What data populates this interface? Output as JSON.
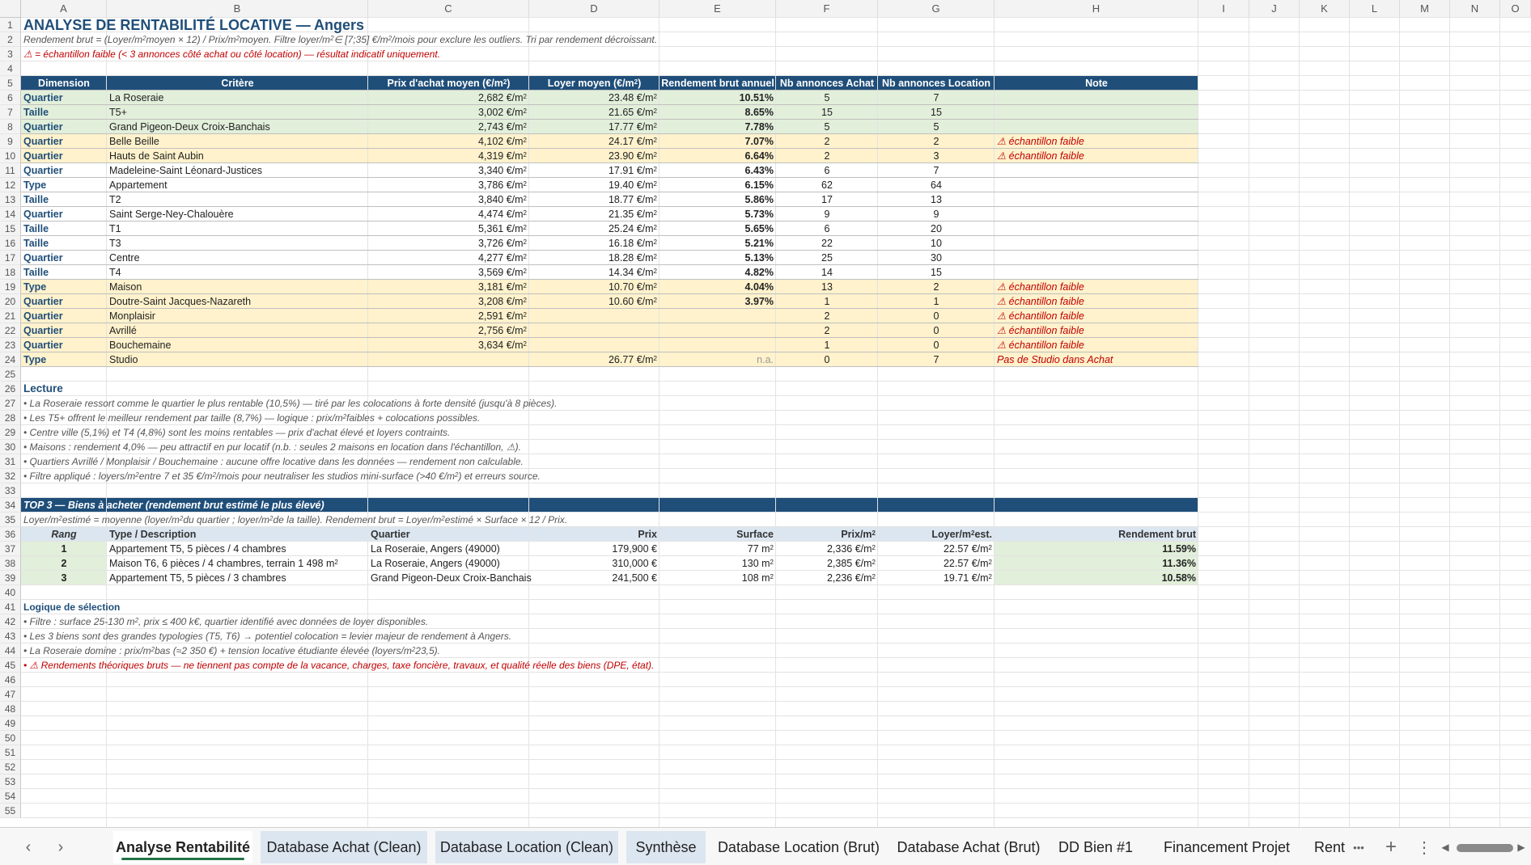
{
  "columns": [
    "A",
    "B",
    "C",
    "D",
    "E",
    "F",
    "G",
    "H",
    "I",
    "J",
    "K",
    "L",
    "M",
    "N",
    "O"
  ],
  "row_numbers": [
    "1",
    "2",
    "3",
    "4",
    "5",
    "6",
    "7",
    "8",
    "9",
    "10",
    "11",
    "12",
    "13",
    "14",
    "15",
    "16",
    "17",
    "18",
    "19",
    "20",
    "21",
    "22",
    "23",
    "24",
    "25",
    "26",
    "27",
    "28",
    "29",
    "30",
    "31",
    "32",
    "33",
    "34",
    "35",
    "36",
    "37",
    "38",
    "39",
    "40",
    "41",
    "42",
    "43",
    "44",
    "45",
    "46",
    "47",
    "48",
    "49",
    "50",
    "51",
    "52",
    "53",
    "54",
    "55"
  ],
  "colors": {
    "header_blue": "#1f4e79",
    "green_fill": "#e2efda",
    "orange_fill": "#fff2cc",
    "warn_red": "#c00000"
  },
  "title": "ANALYSE DE RENTABILITÉ LOCATIVE — Angers",
  "subtitle_parts": [
    "Rendement brut = (Loyer/m",
    " moyen × 12) / Prix/m",
    " moyen. Filtre loyer/m",
    " ∈ [7;35] €/m",
    "/mois pour exclure les outliers. Tri par rendement décroissant."
  ],
  "warning_note": "⚠ = échantillon faible (< 3 annonces côté achat ou côté location) — résultat indicatif uniquement.",
  "table_headers": [
    "Dimension",
    "Critère",
    "Prix d'achat moyen (€/m²)",
    "Loyer moyen (€/m²)",
    "Rendement brut annuel",
    "Nb annonces Achat",
    "Nb annonces Location",
    "Note"
  ],
  "rows": [
    {
      "dim": "Quartier",
      "crit": "La Roseraie",
      "prix": "2,682",
      "loyer": "23.48",
      "rend": "10.51%",
      "na": "5",
      "nl": "7",
      "note": "",
      "style": "green"
    },
    {
      "dim": "Taille",
      "crit": "T5+",
      "prix": "3,002",
      "loyer": "21.65",
      "rend": "8.65%",
      "na": "15",
      "nl": "15",
      "note": "",
      "style": "green"
    },
    {
      "dim": "Quartier",
      "crit": "Grand Pigeon-Deux Croix-Banchais",
      "prix": "2,743",
      "loyer": "17.77",
      "rend": "7.78%",
      "na": "5",
      "nl": "5",
      "note": "",
      "style": "green"
    },
    {
      "dim": "Quartier",
      "crit": "Belle Beille",
      "prix": "4,102",
      "loyer": "24.17",
      "rend": "7.07%",
      "na": "2",
      "nl": "2",
      "note": "⚠ échantillon faible",
      "style": "orange"
    },
    {
      "dim": "Quartier",
      "crit": "Hauts de Saint Aubin",
      "prix": "4,319",
      "loyer": "23.90",
      "rend": "6.64%",
      "na": "2",
      "nl": "3",
      "note": "⚠ échantillon faible",
      "style": "orange"
    },
    {
      "dim": "Quartier",
      "crit": "Madeleine-Saint Léonard-Justices",
      "prix": "3,340",
      "loyer": "17.91",
      "rend": "6.43%",
      "na": "6",
      "nl": "7",
      "note": "",
      "style": "white"
    },
    {
      "dim": "Type",
      "crit": "Appartement",
      "prix": "3,786",
      "loyer": "19.40",
      "rend": "6.15%",
      "na": "62",
      "nl": "64",
      "note": "",
      "style": "white"
    },
    {
      "dim": "Taille",
      "crit": "T2",
      "prix": "3,840",
      "loyer": "18.77",
      "rend": "5.86%",
      "na": "17",
      "nl": "13",
      "note": "",
      "style": "white"
    },
    {
      "dim": "Quartier",
      "crit": "Saint Serge-Ney-Chalouère",
      "prix": "4,474",
      "loyer": "21.35",
      "rend": "5.73%",
      "na": "9",
      "nl": "9",
      "note": "",
      "style": "white"
    },
    {
      "dim": "Taille",
      "crit": "T1",
      "prix": "5,361",
      "loyer": "25.24",
      "rend": "5.65%",
      "na": "6",
      "nl": "20",
      "note": "",
      "style": "white"
    },
    {
      "dim": "Taille",
      "crit": "T3",
      "prix": "3,726",
      "loyer": "16.18",
      "rend": "5.21%",
      "na": "22",
      "nl": "10",
      "note": "",
      "style": "white"
    },
    {
      "dim": "Quartier",
      "crit": "Centre",
      "prix": "4,277",
      "loyer": "18.28",
      "rend": "5.13%",
      "na": "25",
      "nl": "30",
      "note": "",
      "style": "white"
    },
    {
      "dim": "Taille",
      "crit": "T4",
      "prix": "3,569",
      "loyer": "14.34",
      "rend": "4.82%",
      "na": "14",
      "nl": "15",
      "note": "",
      "style": "white"
    },
    {
      "dim": "Type",
      "crit": "Maison",
      "prix": "3,181",
      "loyer": "10.70",
      "rend": "4.04%",
      "na": "13",
      "nl": "2",
      "note": "⚠ échantillon faible",
      "style": "orange"
    },
    {
      "dim": "Quartier",
      "crit": "Doutre-Saint Jacques-Nazareth",
      "prix": "3,208",
      "loyer": "10.60",
      "rend": "3.97%",
      "na": "1",
      "nl": "1",
      "note": "⚠ échantillon faible",
      "style": "orange"
    },
    {
      "dim": "Quartier",
      "crit": "Monplaisir",
      "prix": "2,591",
      "loyer": "",
      "rend": "",
      "na": "2",
      "nl": "0",
      "note": "⚠ échantillon faible",
      "style": "orange"
    },
    {
      "dim": "Quartier",
      "crit": "Avrillé",
      "prix": "2,756",
      "loyer": "",
      "rend": "",
      "na": "2",
      "nl": "0",
      "note": "⚠ échantillon faible",
      "style": "orange"
    },
    {
      "dim": "Quartier",
      "crit": "Bouchemaine",
      "prix": "3,634",
      "loyer": "",
      "rend": "",
      "na": "1",
      "nl": "0",
      "note": "⚠ échantillon faible",
      "style": "orange"
    },
    {
      "dim": "Type",
      "crit": "Studio",
      "prix": "",
      "loyer": "26.77",
      "rend": "n.a.",
      "na": "0",
      "nl": "7",
      "note": "Pas de Studio dans Achat",
      "style": "orange"
    }
  ],
  "unit_prefix": "€/m",
  "unit_sup": "2",
  "lecture_title": "Lecture",
  "lecture_lines": [
    "• La Roseraie ressort comme le quartier le plus rentable (10,5%) — tiré par les colocations à forte densité (jusqu'à 8 pièces).",
    "• Les T5+ offrent le meilleur rendement par taille (8,7%) — logique : prix/m² faibles + colocations possibles.",
    "• Centre ville (5,1%) et T4 (4,8%) sont les moins rentables — prix d'achat élevé et loyers contraints.",
    "• Maisons : rendement 4,0% — peu attractif en pur locatif (n.b. : seules 2 maisons en location dans l'échantillon, ⚠).",
    "• Quartiers Avrillé / Monplaisir / Bouchemaine : aucune offre locative dans les données — rendement non calculable.",
    "• Filtre appliqué : loyers/m² entre 7 et 35 €/m²/mois pour neutraliser les studios mini-surface (>40 €/m²) et erreurs source."
  ],
  "top3_title": "TOP 3 — Biens à acheter (rendement brut estimé le plus élevé)",
  "top3_formula": "Loyer/m² estimé = moyenne (loyer/m² du quartier ; loyer/m² de la taille). Rendement brut = Loyer/m² estimé × Surface × 12 / Prix.",
  "top3_headers": [
    "Rang",
    "Type / Description",
    "Quartier",
    "Prix",
    "Surface",
    "Prix/m²",
    "Loyer/m² est.",
    "Rendement brut"
  ],
  "top3_rows": [
    {
      "rang": "1",
      "desc": "Appartement T5, 5 pièces / 4 chambres",
      "quartier": "La Roseraie, Angers (49000)",
      "prix": "179,900 €",
      "surface": "77 m²",
      "prixm2": "2,336 €/m²",
      "loyer": "22.57 €/m²",
      "rend": "11.59%"
    },
    {
      "rang": "2",
      "desc": "Maison T6, 6 pièces / 4 chambres, terrain 1 498 m²",
      "quartier": "La Roseraie, Angers (49000)",
      "prix": "310,000 €",
      "surface": "130 m²",
      "prixm2": "2,385 €/m²",
      "loyer": "22.57 €/m²",
      "rend": "11.36%"
    },
    {
      "rang": "3",
      "desc": "Appartement T5, 5 pièces / 3 chambres",
      "quartier": "Grand Pigeon-Deux Croix-Banchais",
      "prix": "241,500 €",
      "surface": "108 m²",
      "prixm2": "2,236 €/m²",
      "loyer": "19.71 €/m²",
      "rend": "10.58%"
    }
  ],
  "logic_title": "Logique de sélection",
  "logic_lines": [
    "• Filtre : surface 25-130 m², prix ≤ 400 k€, quartier identifié avec données de loyer disponibles.",
    "• Les 3 biens sont des grandes typologies (T5, T6) → potentiel colocation = levier majeur de rendement à Angers.",
    "• La Roseraie domine : prix/m² bas (≈2 350 €) + tension locative étudiante élevée (loyers/m² 23,5)."
  ],
  "logic_warning": "• ⚠ Rendements théoriques bruts — ne tiennent pas compte de la vacance, charges, taxe foncière, travaux, et qualité réelle des biens (DPE, état).",
  "tabs": [
    "Analyse Rentabilité",
    "Database Achat (Clean)",
    "Database Location (Clean)",
    "Synthèse",
    "Database Location (Brut)",
    "Database Achat (Brut)",
    "DD Bien #1",
    "Financement Projet",
    "Rent"
  ],
  "tab_nav": {
    "prev": "‹",
    "next": "›",
    "more": "•••",
    "add": "+",
    "options": "⋮",
    "scroll_left": "◀",
    "scroll_right": "▶"
  }
}
